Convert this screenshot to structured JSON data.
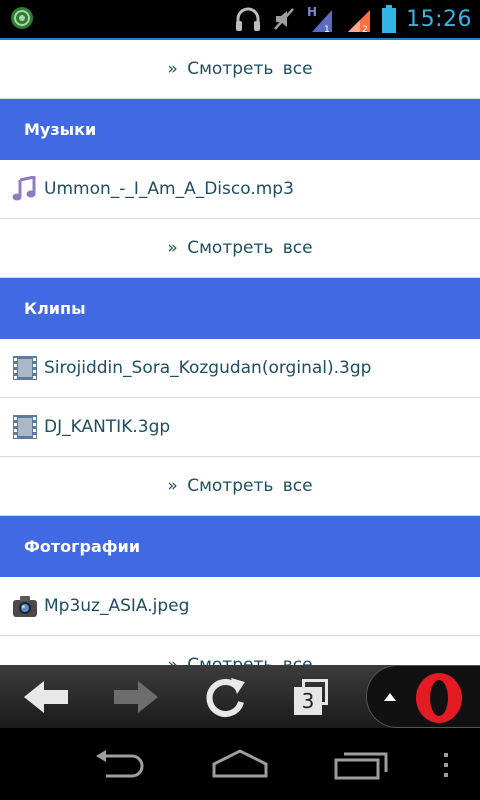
{
  "status_bar": {
    "time": "15:26",
    "icons": [
      "notification-app-icon",
      "headset-icon",
      "mute-icon",
      "signal-h-icon",
      "signal-2-icon",
      "battery-icon"
    ]
  },
  "content": {
    "top_more": "» Смотреть все",
    "sections": [
      {
        "title": "Музыки",
        "items": [
          {
            "name": "Ummon_-_I_Am_A_Disco.mp3",
            "icon": "music-note-icon"
          }
        ],
        "more": "» Смотреть все"
      },
      {
        "title": "Клипы",
        "items": [
          {
            "name": "Sirojiddin_Sora_Kozgudan(orginal).3gp",
            "icon": "film-icon"
          },
          {
            "name": "DJ_KANTIK.3gp",
            "icon": "film-icon"
          }
        ],
        "more": "» Смотреть все"
      },
      {
        "title": "Фотографии",
        "items": [
          {
            "name": "Mp3uz_ASIA.jpeg",
            "icon": "camera-icon"
          }
        ],
        "more": "» Смотреть все"
      }
    ]
  },
  "toolbar": {
    "tab_count": "3",
    "icons": [
      "back-arrow-icon",
      "forward-arrow-icon",
      "reload-icon",
      "tabs-icon",
      "menu-up-icon",
      "opera-logo-icon"
    ]
  },
  "navbar": {
    "icons": [
      "nav-back-icon",
      "nav-home-icon",
      "nav-recents-icon",
      "overflow-menu-icon"
    ]
  },
  "colors": {
    "section_bg": "#4169e1",
    "link_text": "#1e4e62",
    "status_accent": "#33b5e5"
  }
}
